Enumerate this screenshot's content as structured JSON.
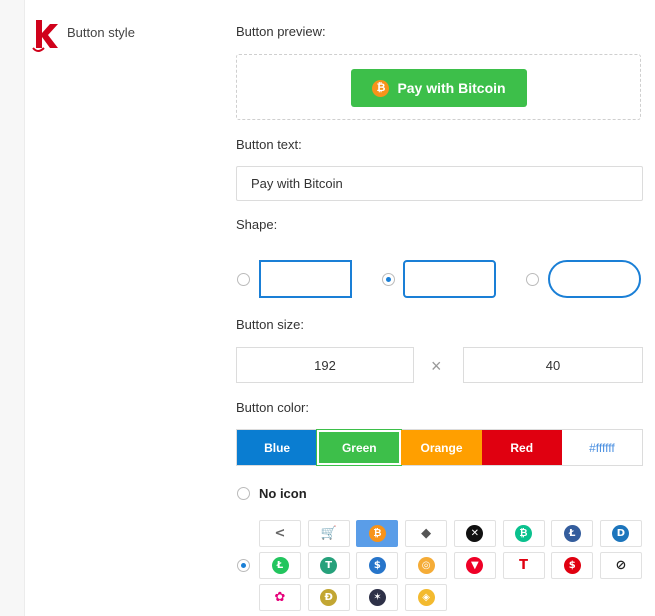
{
  "sidebar": {
    "title": "Button style"
  },
  "labels": {
    "preview": "Button preview:",
    "button_text": "Button text:",
    "shape": "Shape:",
    "size": "Button size:",
    "color": "Button color:",
    "no_icon": "No icon"
  },
  "preview": {
    "button_label": "Pay with Bitcoin",
    "icon": "bitcoin-icon"
  },
  "button_text": {
    "value": "Pay with Bitcoin"
  },
  "shape": {
    "options": [
      "square",
      "rounded",
      "pill"
    ],
    "selected": "rounded"
  },
  "size": {
    "width": "192",
    "separator": "×",
    "height": "40"
  },
  "colors": {
    "options": [
      {
        "label": "Blue",
        "hex": "#0a7dd1"
      },
      {
        "label": "Green",
        "hex": "#3dbf4a"
      },
      {
        "label": "Orange",
        "hex": "#ff9f00"
      },
      {
        "label": "Red",
        "hex": "#e00010"
      },
      {
        "label": "#ffffff",
        "hex": "#ffffff"
      }
    ],
    "selected": "Green"
  },
  "icons": {
    "selected": "bitcoin-icon",
    "items": [
      {
        "name": "kraken-icon",
        "glyph": "<",
        "bg": "#ffffff",
        "fg": "#666666"
      },
      {
        "name": "cart-icon",
        "glyph": "🛒",
        "bg": "#ffffff",
        "fg": "#555555"
      },
      {
        "name": "bitcoin-icon",
        "glyph": "₿",
        "bg": "#f7931a",
        "fg": "#ffffff"
      },
      {
        "name": "ethereum-icon",
        "glyph": "◆",
        "bg": "#ffffff",
        "fg": "#555555"
      },
      {
        "name": "xrp-icon",
        "glyph": "✕",
        "bg": "#111111",
        "fg": "#ffffff"
      },
      {
        "name": "bitcoin-cash-icon",
        "glyph": "₿",
        "bg": "#0ac18e",
        "fg": "#ffffff"
      },
      {
        "name": "litecoin-icon",
        "glyph": "Ł",
        "bg": "#345d9d",
        "fg": "#ffffff"
      },
      {
        "name": "dash-icon",
        "glyph": "D",
        "bg": "#1c75bc",
        "fg": "#ffffff"
      },
      {
        "name": "litecoin-green-icon",
        "glyph": "Ł",
        "bg": "#22c55e",
        "fg": "#ffffff"
      },
      {
        "name": "tether-icon",
        "glyph": "T",
        "bg": "#26a17b",
        "fg": "#ffffff"
      },
      {
        "name": "usdc-icon",
        "glyph": "$",
        "bg": "#2775ca",
        "fg": "#ffffff"
      },
      {
        "name": "dai-icon",
        "glyph": "◎",
        "bg": "#f5ac37",
        "fg": "#ffffff"
      },
      {
        "name": "tron-icon",
        "glyph": "▼",
        "bg": "#ef0027",
        "fg": "#ffffff"
      },
      {
        "name": "trueusd-icon",
        "glyph": "T",
        "bg": "#ffffff",
        "fg": "#e00010"
      },
      {
        "name": "usd-red-icon",
        "glyph": "$",
        "bg": "#e00010",
        "fg": "#ffffff"
      },
      {
        "name": "stellar-icon",
        "glyph": "⊘",
        "bg": "#ffffff",
        "fg": "#222222"
      },
      {
        "name": "polkadot-icon",
        "glyph": "✿",
        "bg": "#ffffff",
        "fg": "#e6007a"
      },
      {
        "name": "dogecoin-icon",
        "glyph": "Ð",
        "bg": "#c2a633",
        "fg": "#ffffff"
      },
      {
        "name": "cosmos-icon",
        "glyph": "✶",
        "bg": "#2e3148",
        "fg": "#ffffff"
      },
      {
        "name": "binance-icon",
        "glyph": "◈",
        "bg": "#f3ba2f",
        "fg": "#ffffff"
      }
    ]
  }
}
